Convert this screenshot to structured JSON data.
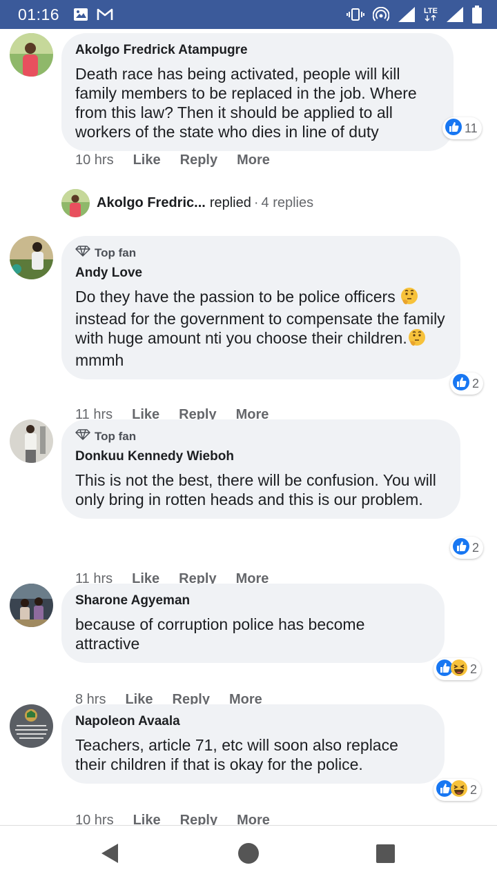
{
  "status_bar": {
    "time": "01:16",
    "network": "LTE",
    "icons": [
      "image-icon",
      "gmail-icon",
      "vibrate-icon",
      "hotspot-icon",
      "signal-icon",
      "lte-icon",
      "signal-icon",
      "battery-icon"
    ]
  },
  "actions": {
    "like": "Like",
    "reply": "Reply",
    "more": "More"
  },
  "badge": {
    "top_fan": "Top fan"
  },
  "comments": [
    {
      "author": "Akolgo Fredrick Atampugre",
      "text": "Death race has being activated, people will kill family members to be replaced in the job. Where from this law? Then it should be applied to all workers of the state who dies in line of duty",
      "time": "10 hrs",
      "reactions": "11",
      "reaction_types": [
        "like"
      ]
    },
    {
      "author": "Andy Love",
      "top_fan": true,
      "text_parts": [
        "Do they have the passion to be police officers ",
        " instead for the government to compensate the family with huge amount nti you choose their children.",
        "mmmh"
      ],
      "time": "11 hrs",
      "reactions": "2",
      "reaction_types": [
        "like"
      ]
    },
    {
      "author": "Donkuu Kennedy Wieboh",
      "top_fan": true,
      "text": "This is not the best, there will be confusion. You will only bring in rotten heads and this is our problem.",
      "time": "11 hrs",
      "reactions": "2",
      "reaction_types": [
        "like"
      ]
    },
    {
      "author": "Sharone Agyeman",
      "text": "because of corruption police has become attractive",
      "time": "8 hrs",
      "reactions": "2",
      "reaction_types": [
        "like",
        "haha"
      ]
    },
    {
      "author": "Napoleon Avaala",
      "text": "Teachers, article 71, etc will soon also replace their children if that is okay for the police.",
      "time": "10 hrs",
      "reactions": "2",
      "reaction_types": [
        "like",
        "haha"
      ]
    }
  ],
  "reply_summary": {
    "author": "Akolgo Fredric...",
    "verb": "replied",
    "separator": "·",
    "count": "4 replies"
  },
  "colors": {
    "status_bar": "#3b5a9a",
    "bubble": "#f0f2f5",
    "like_blue": "#1877f2",
    "meta_gray": "#65676b"
  }
}
